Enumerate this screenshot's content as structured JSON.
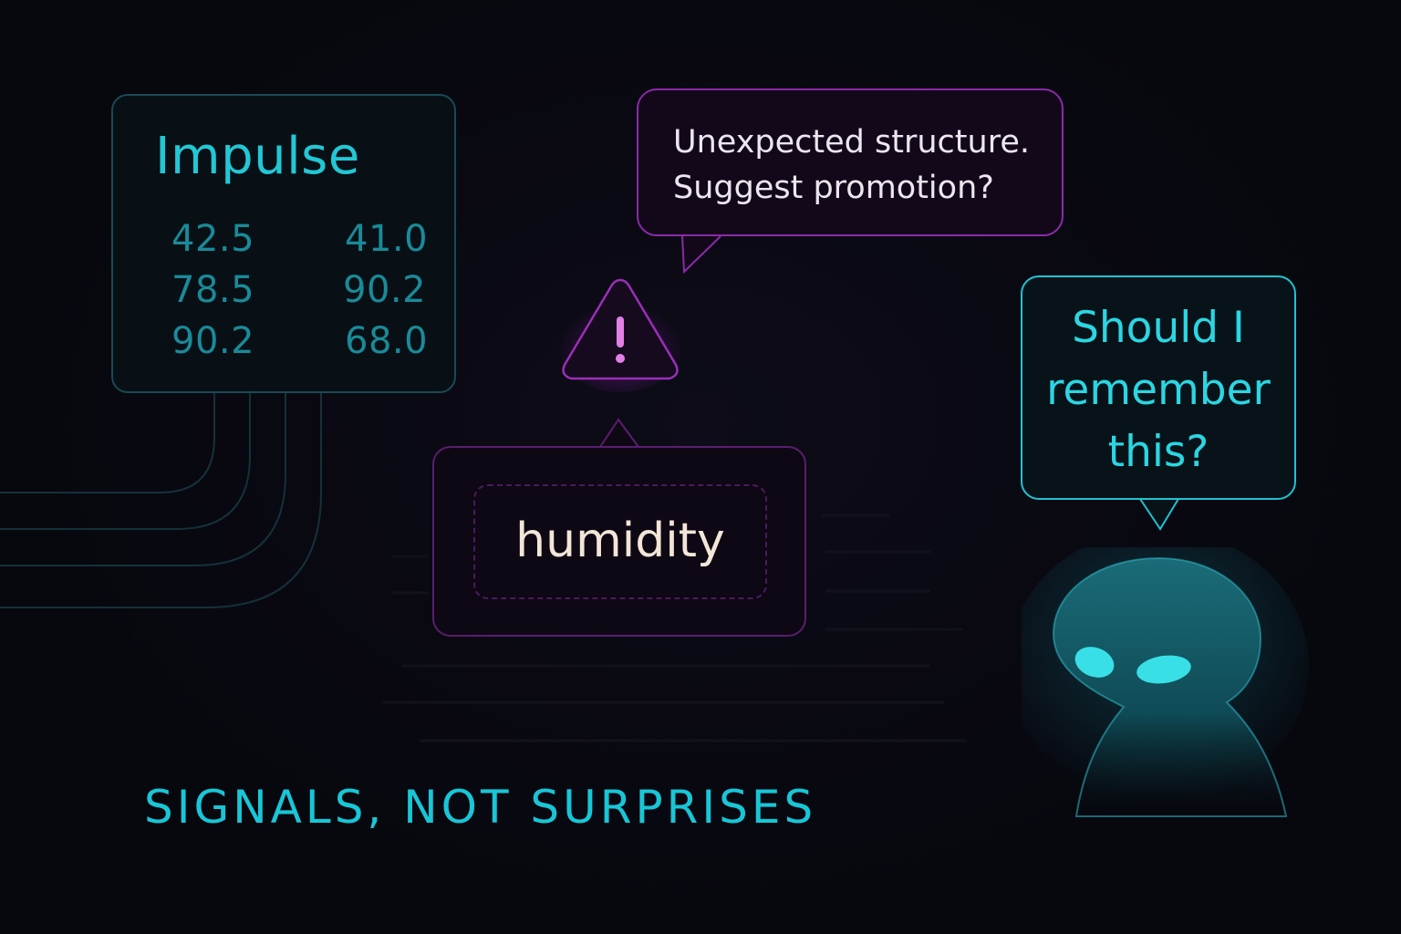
{
  "impulse": {
    "title": "Impulse",
    "values": [
      "42.5",
      "41.0",
      "78.5",
      "90.2",
      "90.2",
      "68.0"
    ]
  },
  "alert_bubble": {
    "text": "Unexpected structure.\nSuggest promotion?"
  },
  "term_bubble": {
    "text": "humidity"
  },
  "assistant_bubble": {
    "text": "Should I\nremember\nthis?"
  },
  "tagline": "SIGNALS, NOT SURPRISES",
  "icons": {
    "warning": "warning-triangle-icon",
    "assistant": "ghost-assistant-icon"
  },
  "colors": {
    "cyan": "#22c7d4",
    "purple": "#8b2aa8",
    "background": "#07070e"
  }
}
